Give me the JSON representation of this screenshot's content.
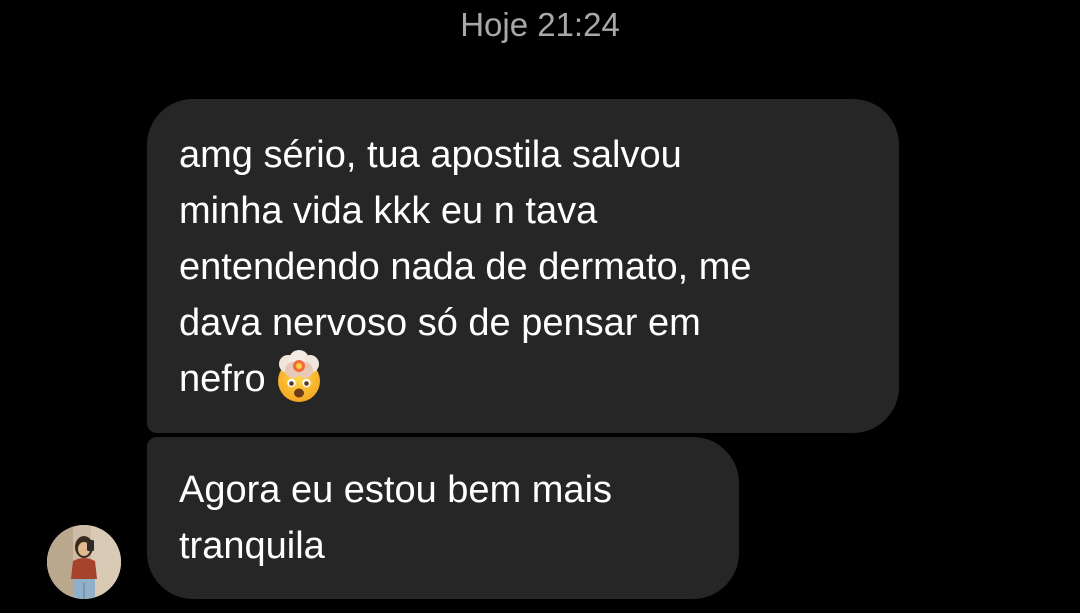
{
  "conversation": {
    "timestamp": "Hoje 21:24",
    "messages": [
      {
        "text": "amg sério, tua apostila salvou\nminha vida kkk eu n tava\nentendendo nada de dermato, me\ndava nervoso só de pensar em\nnefro",
        "emoji": "exploding-head-icon"
      },
      {
        "text": "Agora eu estou bem mais\ntranquila"
      }
    ]
  },
  "colors": {
    "background": "#000000",
    "bubble": "#262626",
    "text": "#ffffff",
    "timestamp": "#a8a8a8"
  }
}
